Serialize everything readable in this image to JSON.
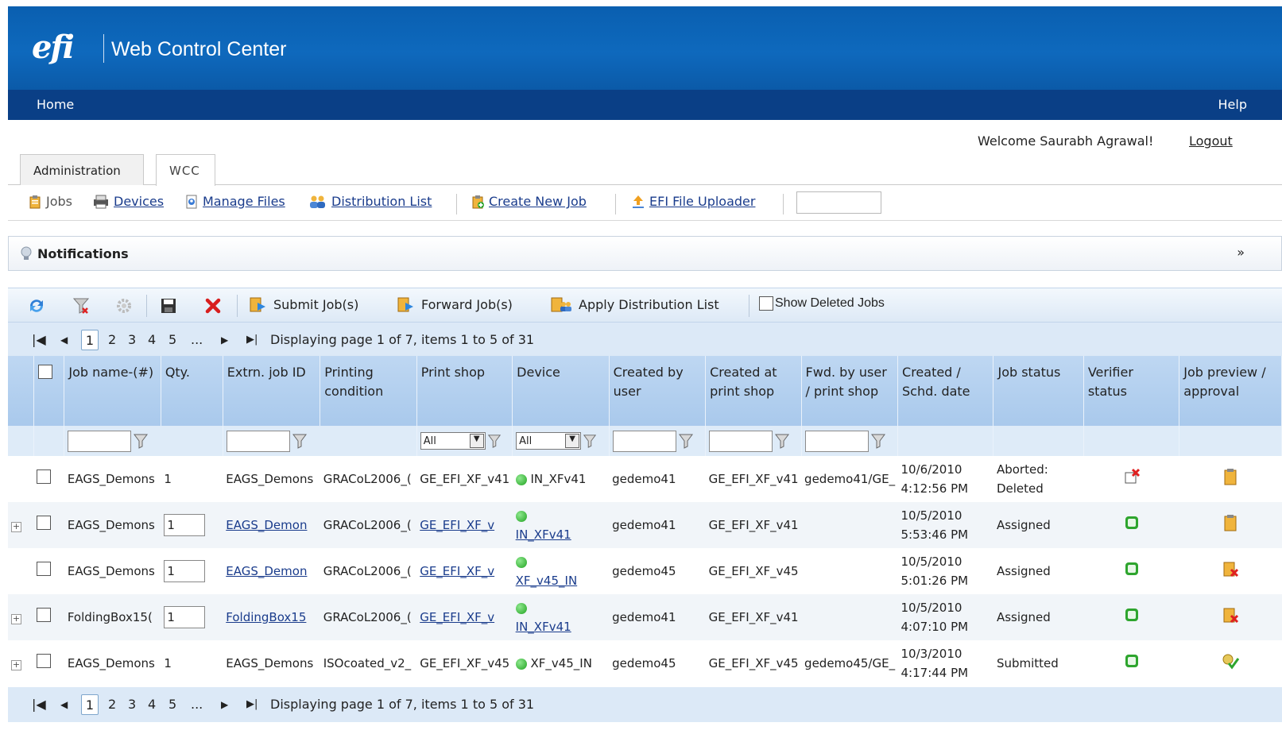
{
  "app": {
    "logo": "efi",
    "title": "Web Control Center"
  },
  "nav": {
    "home": "Home",
    "help": "Help"
  },
  "user": {
    "welcome": "Welcome Saurabh Agrawal!",
    "logout": "Logout"
  },
  "tabs": [
    {
      "label": "Administration"
    },
    {
      "label": "WCC"
    }
  ],
  "links": {
    "jobs": "Jobs",
    "devices": "Devices",
    "manage_files": "Manage Files",
    "distribution_list": "Distribution List",
    "create_new_job": "Create New Job",
    "file_uploader": "EFI File Uploader"
  },
  "notifications": {
    "label": "Notifications"
  },
  "grid_toolbar": {
    "submit": "Submit Job(s)",
    "forward": "Forward Job(s)",
    "apply_dist": "Apply Distribution List",
    "show_deleted": "Show Deleted Jobs"
  },
  "pager": {
    "pages": [
      "1",
      "2",
      "3",
      "4",
      "5",
      "..."
    ],
    "info": "Displaying page 1 of 7, items 1 to 5 of 31"
  },
  "columns": {
    "job_name": "Job name-(#)",
    "qty": "Qty.",
    "extrn_id": "Extrn. job ID",
    "printing_condition": "Printing condition",
    "print_shop": "Print shop",
    "device": "Device",
    "created_by": "Created by user",
    "created_at": "Created at print shop",
    "fwd_by": "Fwd. by user / print shop",
    "created_date": "Created / Schd. date",
    "job_status": "Job status",
    "verifier": "Verifier status",
    "preview": "Job preview / approval"
  },
  "filters": {
    "print_shop": "All",
    "device": "All"
  },
  "rows": [
    {
      "name": "EAGS_Demons",
      "qty": "1",
      "extrn": "EAGS_Demons",
      "cond": "GRACoL2006_(",
      "shop": "GE_EFI_XF_v41",
      "device": "IN_XFv41",
      "by": "gedemo41",
      "at": "GE_EFI_XF_v41",
      "fwd": "gedemo41/GE_",
      "date1": "10/6/2010",
      "date2": "4:12:56 PM",
      "status1": "Aborted:",
      "status2": "Deleted"
    },
    {
      "name": "EAGS_Demons",
      "qty": "1",
      "extrn": "EAGS_Demon",
      "cond": "GRACoL2006_(",
      "shop": "GE_EFI_XF_v",
      "device": "IN_XFv41",
      "by": "gedemo41",
      "at": "GE_EFI_XF_v41",
      "fwd": "",
      "date1": "10/5/2010",
      "date2": "5:53:46 PM",
      "status1": "Assigned",
      "status2": ""
    },
    {
      "name": "EAGS_Demons",
      "qty": "1",
      "extrn": "EAGS_Demon",
      "cond": "GRACoL2006_(",
      "shop": "GE_EFI_XF_v",
      "device": "XF_v45_IN",
      "by": "gedemo45",
      "at": "GE_EFI_XF_v45",
      "fwd": "",
      "date1": "10/5/2010",
      "date2": "5:01:26 PM",
      "status1": "Assigned",
      "status2": ""
    },
    {
      "name": "FoldingBox15(",
      "qty": "1",
      "extrn": "FoldingBox15",
      "cond": "GRACoL2006_(",
      "shop": "GE_EFI_XF_v",
      "device": "IN_XFv41",
      "by": "gedemo41",
      "at": "GE_EFI_XF_v41",
      "fwd": "",
      "date1": "10/5/2010",
      "date2": "4:07:10 PM",
      "status1": "Assigned",
      "status2": ""
    },
    {
      "name": "EAGS_Demons",
      "qty": "1",
      "extrn": "EAGS_Demons",
      "cond": "ISOcoated_v2_",
      "shop": "GE_EFI_XF_v45",
      "device": "XF_v45_IN",
      "by": "gedemo45",
      "at": "GE_EFI_XF_v45",
      "fwd": "gedemo45/GE_",
      "date1": "10/3/2010",
      "date2": "4:17:44 PM",
      "status1": "Submitted",
      "status2": ""
    }
  ],
  "colors": {
    "header": "#0e69bd",
    "navbar": "#0a3f86",
    "grid_header": "#b4d0ef",
    "link": "#1a3c8c"
  }
}
